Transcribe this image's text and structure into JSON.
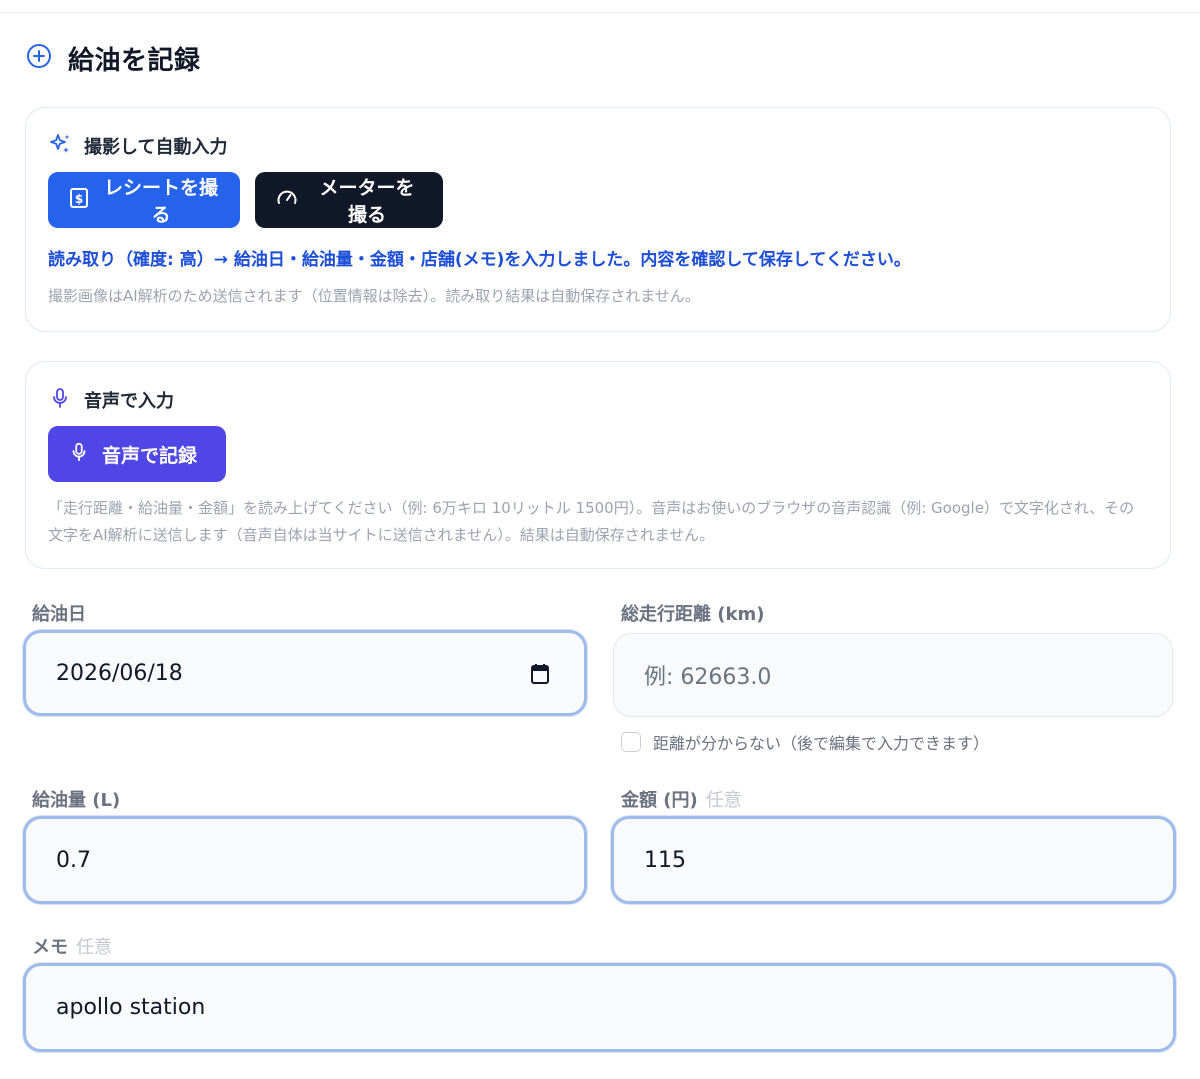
{
  "page": {
    "title": "給油を記録"
  },
  "photo_card": {
    "title": "撮影して自動入力",
    "receipt_button": "レシートを撮る",
    "meter_button": "メーターを撮る",
    "status": "読み取り（確度: 高）→ 給油日・給油量・金額・店舗(メモ)を入力しました。内容を確認して保存してください。",
    "note": "撮影画像はAI解析のため送信されます（位置情報は除去）。読み取り結果は自動保存されません。"
  },
  "voice_card": {
    "title": "音声で入力",
    "record_button": "音声で記録",
    "note": "「走行距離・給油量・金額」を読み上げてください（例: 6万キロ 10リットル 1500円）。音声はお使いのブラウザの音声認識（例: Google）で文字化され、その文字をAI解析に送信します（音声自体は当サイトに送信されません）。結果は自動保存されません。"
  },
  "form": {
    "date": {
      "label": "給油日",
      "value": "2026/06/18"
    },
    "odometer": {
      "label": "総走行距離 (km)",
      "placeholder": "例: 62663.0",
      "unknown_label": "距離が分からない（後で編集で入力できます）"
    },
    "amount": {
      "label": "給油量 (L)",
      "value": "0.7"
    },
    "price": {
      "label": "金額 (円)",
      "optional": "任意",
      "value": "115"
    },
    "memo": {
      "label": "メモ",
      "optional": "任意",
      "value": "apollo station"
    }
  },
  "colors": {
    "primary": "#2563eb",
    "dark": "#111827",
    "voice": "#4f46e5",
    "status": "#1d4ed8",
    "focus_border": "#9fbbea"
  }
}
